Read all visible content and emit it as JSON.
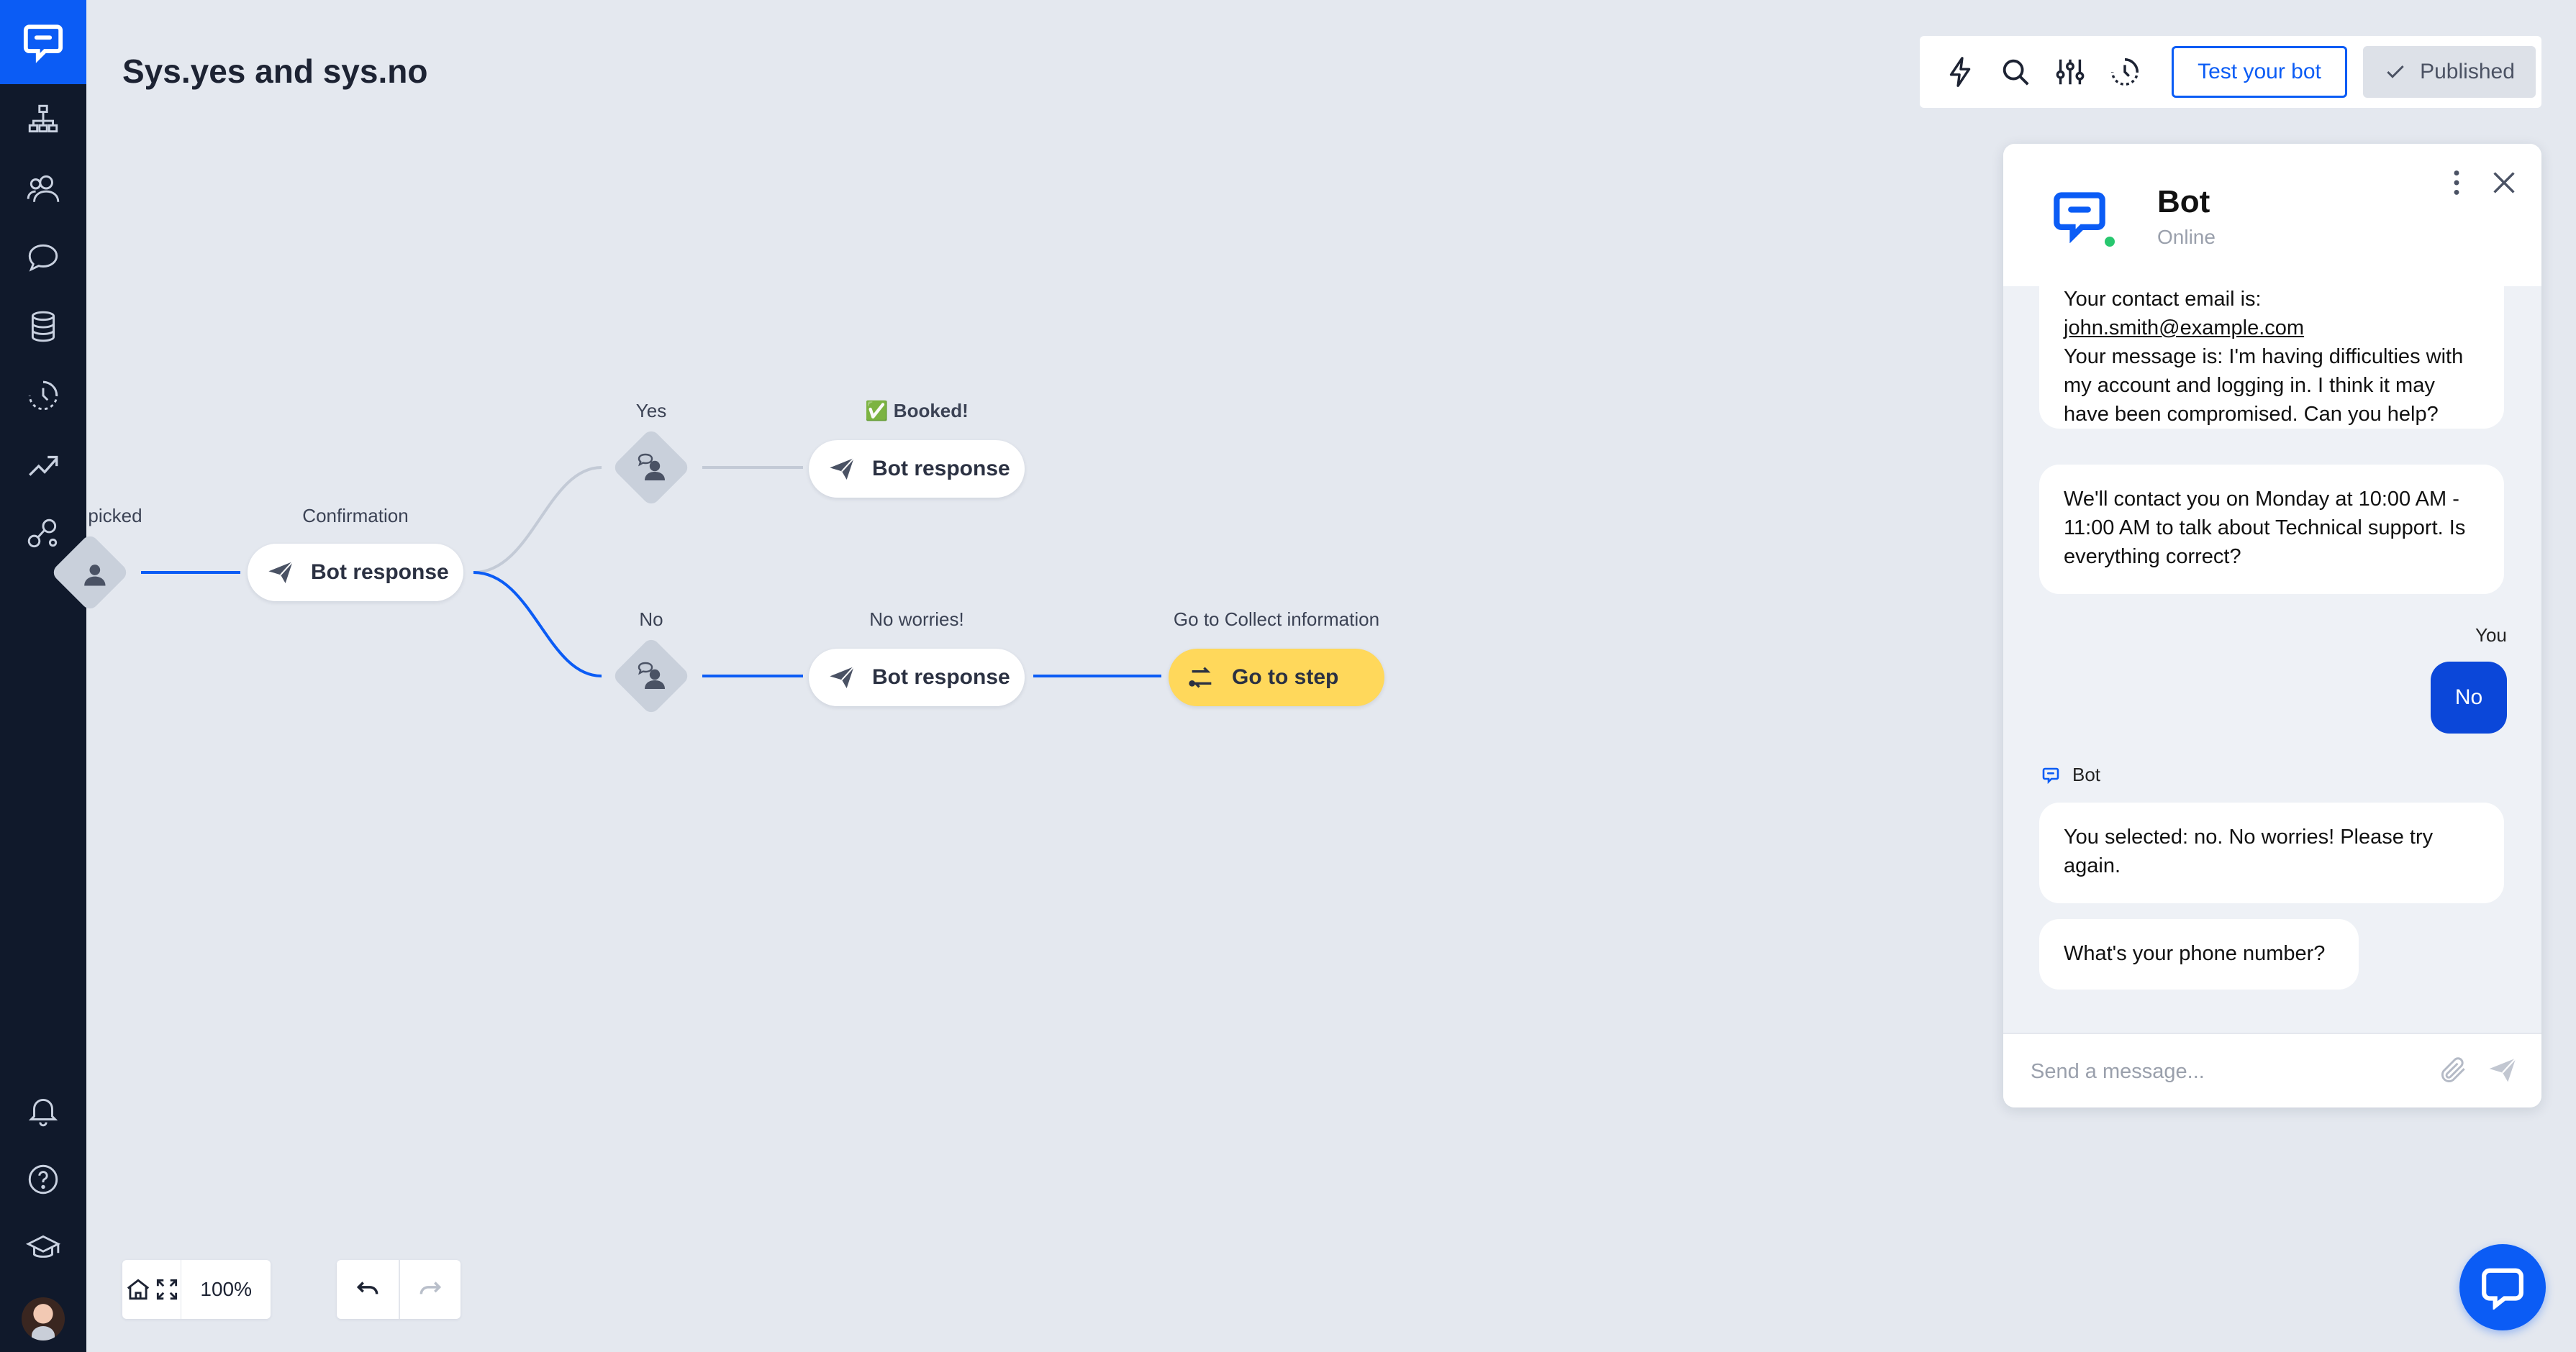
{
  "page": {
    "title": "Sys.yes and sys.no"
  },
  "sidebar": {
    "items": [
      {
        "icon": "chatbot-logo-icon"
      },
      {
        "icon": "stories-icon"
      },
      {
        "icon": "audience-icon"
      },
      {
        "icon": "chats-icon"
      },
      {
        "icon": "data-icon"
      },
      {
        "icon": "archives-icon"
      },
      {
        "icon": "reports-icon"
      },
      {
        "icon": "integrations-icon"
      },
      {
        "icon": "notifications-icon"
      },
      {
        "icon": "help-icon"
      },
      {
        "icon": "academy-icon"
      }
    ]
  },
  "toolbar": {
    "test_label": "Test your bot",
    "published_label": "Published"
  },
  "flow": {
    "picked_label": "picked",
    "confirmation_label": "Confirmation",
    "confirmation_response": "Bot response",
    "yes_label": "Yes",
    "booked_label": "✅ Booked!",
    "yes_response": "Bot response",
    "no_label": "No",
    "noworries_label": "No worries!",
    "no_response": "Bot response",
    "goto_label": "Go to Collect information",
    "goto_button": "Go to step"
  },
  "controls": {
    "zoom": "100%"
  },
  "chat": {
    "bot_name": "Bot",
    "bot_status": "Online",
    "messages": {
      "m1_line1": "Your contact email is:",
      "m1_email": "john.smith@example.com",
      "m1_rest": "Your message is: I'm having difficulties with my account and logging in. I think it may have been compromised. Can you help?",
      "m2": "We'll contact you on Monday at 10:00 AM - 11:00 AM to talk about Technical support. Is everything correct?",
      "you_label": "You",
      "user_reply": "No",
      "bot_label": "Bot",
      "m3": "You selected: no. No worries! Please try again.",
      "m4": "What's your phone number?"
    },
    "composer_placeholder": "Send a message..."
  },
  "colors": {
    "brand_blue": "#0b5cf5",
    "sidebar_bg": "#10192b",
    "canvas_bg": "#e4e8ef",
    "goto_yellow": "#ffd85b",
    "online_green": "#28c76f"
  }
}
